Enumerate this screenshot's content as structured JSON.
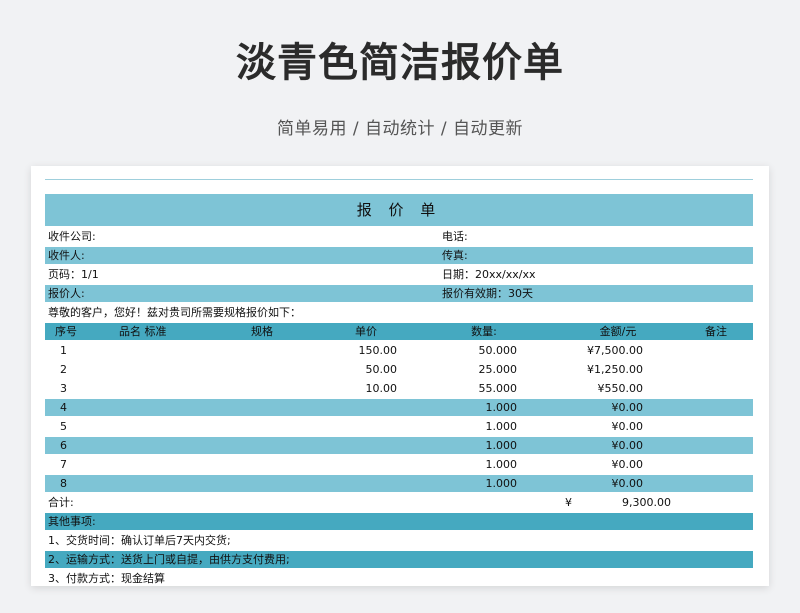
{
  "hero": {
    "title": "淡青色简洁报价单",
    "subtitle": "简单易用 / 自动统计 / 自动更新"
  },
  "quote": {
    "title": "报 价 单",
    "info": [
      {
        "left": "收件公司:",
        "right": "电话:"
      },
      {
        "left": "收件人:",
        "right": "传真:"
      },
      {
        "left": "页码：1/1",
        "right": "日期：20xx/xx/xx"
      },
      {
        "left": "报价人:",
        "right": "报价有效期：30天"
      }
    ],
    "greeting": "尊敬的客户，您好！兹对贵司所需要规格报价如下：",
    "headers": {
      "seq": "序号",
      "name": "品名 标准",
      "spec": "规格",
      "price": "单价",
      "qty": "数量:",
      "amount": "金额/元",
      "note": "备注"
    },
    "items": [
      {
        "seq": "1",
        "price": "150.00",
        "qty": "50.000",
        "amount": "¥7,500.00"
      },
      {
        "seq": "2",
        "price": "50.00",
        "qty": "25.000",
        "amount": "¥1,250.00"
      },
      {
        "seq": "3",
        "price": "10.00",
        "qty": "55.000",
        "amount": "¥550.00"
      },
      {
        "seq": "4",
        "price": "",
        "qty": "1.000",
        "amount": "¥0.00"
      },
      {
        "seq": "5",
        "price": "",
        "qty": "1.000",
        "amount": "¥0.00"
      },
      {
        "seq": "6",
        "price": "",
        "qty": "1.000",
        "amount": "¥0.00"
      },
      {
        "seq": "7",
        "price": "",
        "qty": "1.000",
        "amount": "¥0.00"
      },
      {
        "seq": "8",
        "price": "",
        "qty": "1.000",
        "amount": "¥0.00"
      }
    ],
    "total": {
      "label": "合计:",
      "symbol": "¥",
      "value": "9,300.00"
    },
    "notes_title": "其他事项:",
    "notes": [
      "1、交货时间：确认订单后7天内交货;",
      "2、运输方式：送货上门或自提，由供方支付费用;",
      "3、付款方式：现金结算"
    ]
  }
}
